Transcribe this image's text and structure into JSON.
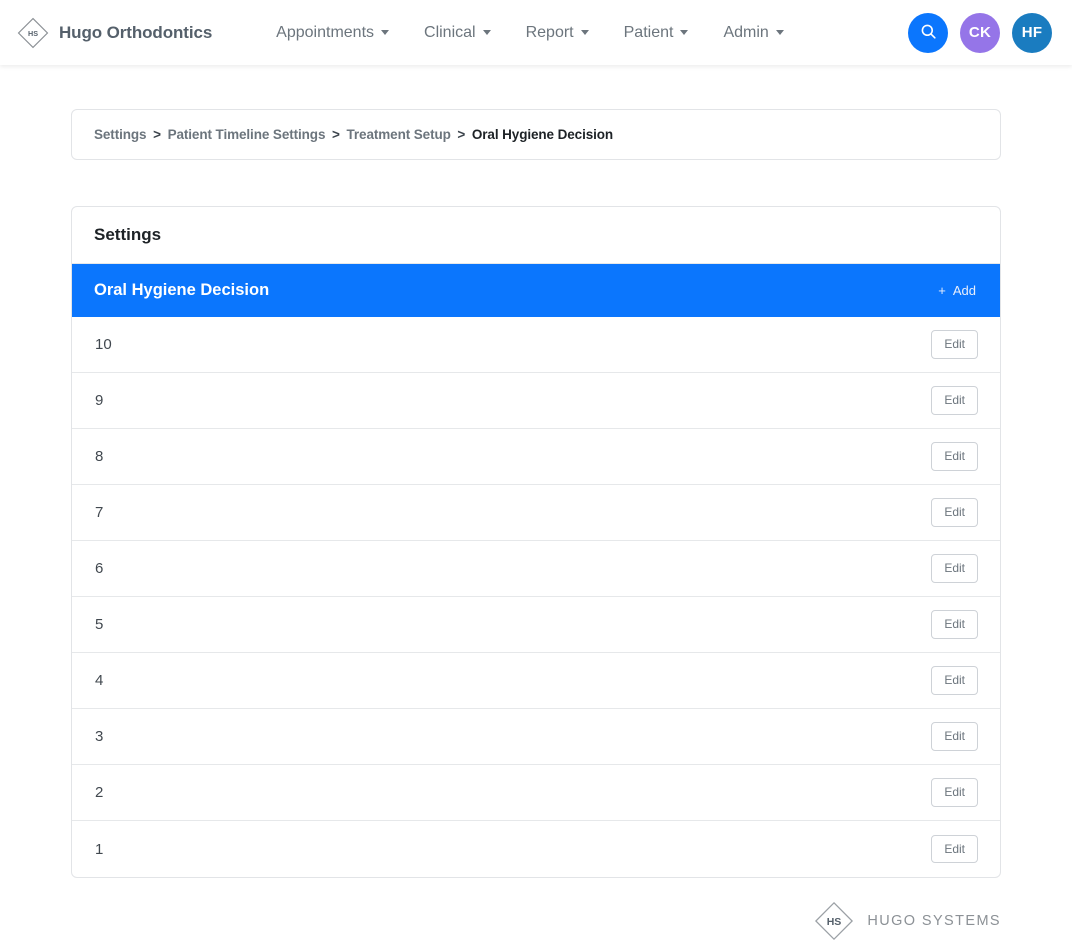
{
  "navbar": {
    "brand": {
      "name": "Hugo Orthodontics",
      "logo_text": "HS"
    },
    "links": [
      {
        "label": "Appointments"
      },
      {
        "label": "Clinical"
      },
      {
        "label": "Report"
      },
      {
        "label": "Patient"
      },
      {
        "label": "Admin"
      }
    ],
    "search": {
      "icon": "search-icon"
    },
    "avatars": [
      {
        "initials": "CK",
        "color": "#9575e8"
      },
      {
        "initials": "HF",
        "color": "#1a7cc0"
      }
    ]
  },
  "breadcrumb": {
    "items": [
      "Settings",
      "Patient Timeline Settings",
      "Treatment Setup"
    ],
    "separator": ">",
    "current": "Oral Hygiene Decision"
  },
  "settings": {
    "title": "Settings",
    "section": {
      "title": "Oral Hygiene Decision",
      "accent_color": "#0b76fd",
      "add_label": "Add",
      "add_icon": "plus-icon"
    },
    "edit_label": "Edit",
    "rows": [
      {
        "label": "10"
      },
      {
        "label": "9"
      },
      {
        "label": "8"
      },
      {
        "label": "7"
      },
      {
        "label": "6"
      },
      {
        "label": "5"
      },
      {
        "label": "4"
      },
      {
        "label": "3"
      },
      {
        "label": "2"
      },
      {
        "label": "1"
      }
    ]
  },
  "footer": {
    "name": "HUGO SYSTEMS",
    "logo_text": "HS"
  }
}
